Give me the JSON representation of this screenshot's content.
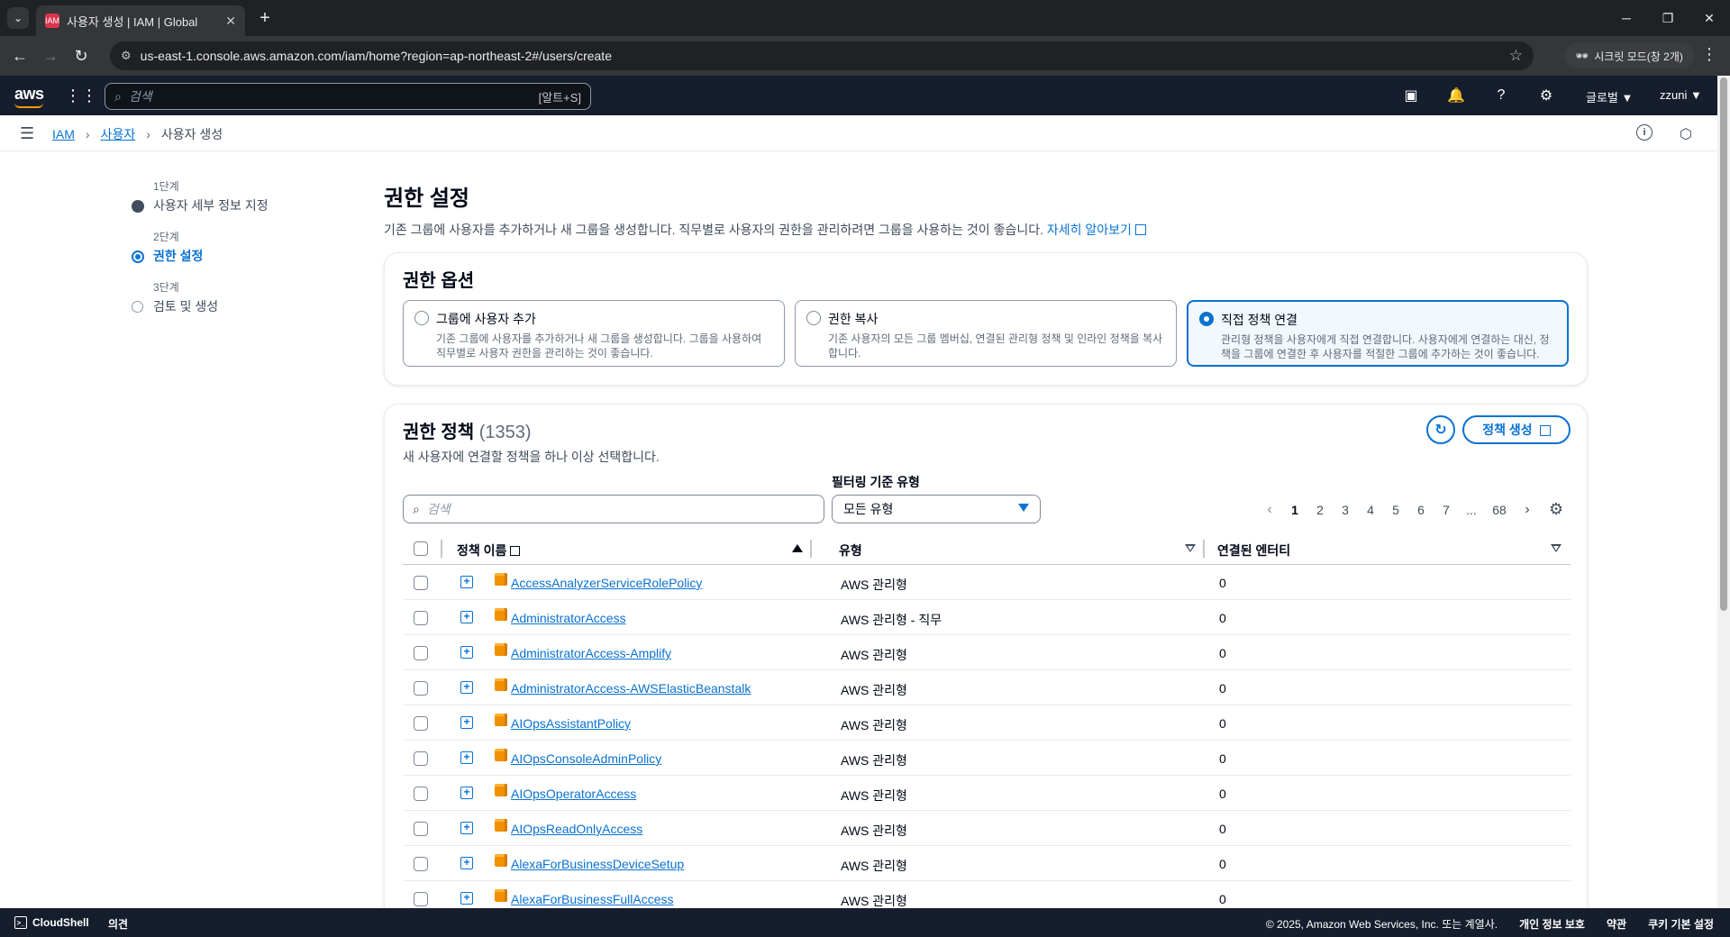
{
  "browser": {
    "tab_title": "사용자 생성 | IAM | Global",
    "favicon_text": "IAM",
    "url": "us-east-1.console.aws.amazon.com/iam/home?region=ap-northeast-2#/users/create",
    "incognito_label": "시크릿 모드(창 2개)"
  },
  "awsnav": {
    "logo": "aws",
    "search_placeholder": "검색",
    "search_shortcut": "[알트+S]",
    "region": "글로벌 ▼",
    "user": "zzuni ▼"
  },
  "breadcrumb": {
    "items": [
      "IAM",
      "사용자"
    ],
    "current": "사용자 생성"
  },
  "steps": [
    {
      "num": "1단계",
      "label": "사용자 세부 정보 지정",
      "state": "done"
    },
    {
      "num": "2단계",
      "label": "권한 설정",
      "state": "current"
    },
    {
      "num": "3단계",
      "label": "검토 및 생성",
      "state": "todo"
    }
  ],
  "page": {
    "title": "권한 설정",
    "description": "기존 그룹에 사용자를 추가하거나 새 그룹을 생성합니다. 직무별로 사용자의 권한을 관리하려면 그룹을 사용하는 것이 좋습니다.",
    "learn_more": "자세히 알아보기"
  },
  "permission_options": {
    "title": "권한 옵션",
    "options": [
      {
        "label": "그룹에 사용자 추가",
        "desc": "기존 그룹에 사용자를 추가하거나 새 그룹을 생성합니다. 그룹을 사용하여 직무별로 사용자 권한을 관리하는 것이 좋습니다.",
        "selected": false
      },
      {
        "label": "권한 복사",
        "desc": "기존 사용자의 모든 그룹 멤버십, 연결된 관리형 정책 및 인라인 정책을 복사합니다.",
        "selected": false
      },
      {
        "label": "직접 정책 연결",
        "desc": "관리형 정책을 사용자에게 직접 연결합니다. 사용자에게 연결하는 대신, 정책을 그룹에 연결한 후 사용자를 적절한 그룹에 추가하는 것이 좋습니다.",
        "selected": true
      }
    ]
  },
  "policies": {
    "title": "권한 정책",
    "count": "(1353)",
    "description": "새 사용자에 연결할 정책을 하나 이상 선택합니다.",
    "create_label": "정책 생성",
    "filter_label": "필터링 기준 유형",
    "search_placeholder": "검색",
    "type_filter_value": "모든 유형",
    "pages": [
      "1",
      "2",
      "3",
      "4",
      "5",
      "6",
      "7",
      "...",
      "68"
    ],
    "current_page": "1",
    "columns": {
      "name": "정책 이름",
      "type": "유형",
      "entities": "연결된 엔터티"
    },
    "rows": [
      {
        "name": "AccessAnalyzerServiceRolePolicy",
        "type": "AWS 관리형",
        "entities": "0"
      },
      {
        "name": "AdministratorAccess",
        "type": "AWS 관리형 - 직무",
        "entities": "0"
      },
      {
        "name": "AdministratorAccess-Amplify",
        "type": "AWS 관리형",
        "entities": "0"
      },
      {
        "name": "AdministratorAccess-AWSElasticBeanstalk",
        "type": "AWS 관리형",
        "entities": "0"
      },
      {
        "name": "AIOpsAssistantPolicy",
        "type": "AWS 관리형",
        "entities": "0"
      },
      {
        "name": "AIOpsConsoleAdminPolicy",
        "type": "AWS 관리형",
        "entities": "0"
      },
      {
        "name": "AIOpsOperatorAccess",
        "type": "AWS 관리형",
        "entities": "0"
      },
      {
        "name": "AIOpsReadOnlyAccess",
        "type": "AWS 관리형",
        "entities": "0"
      },
      {
        "name": "AlexaForBusinessDeviceSetup",
        "type": "AWS 관리형",
        "entities": "0"
      },
      {
        "name": "AlexaForBusinessFullAccess",
        "type": "AWS 관리형",
        "entities": "0"
      }
    ]
  },
  "footer": {
    "cloudshell": "CloudShell",
    "feedback": "의견",
    "copyright": "© 2025, Amazon Web Services, Inc. 또는 계열사.",
    "privacy": "개인 정보 보호",
    "terms": "약관",
    "cookies": "쿠키 기본 설정"
  },
  "colors": {
    "accent": "#0972d3",
    "nav_bg": "#161e2d",
    "policy_icon": "#f29100"
  }
}
